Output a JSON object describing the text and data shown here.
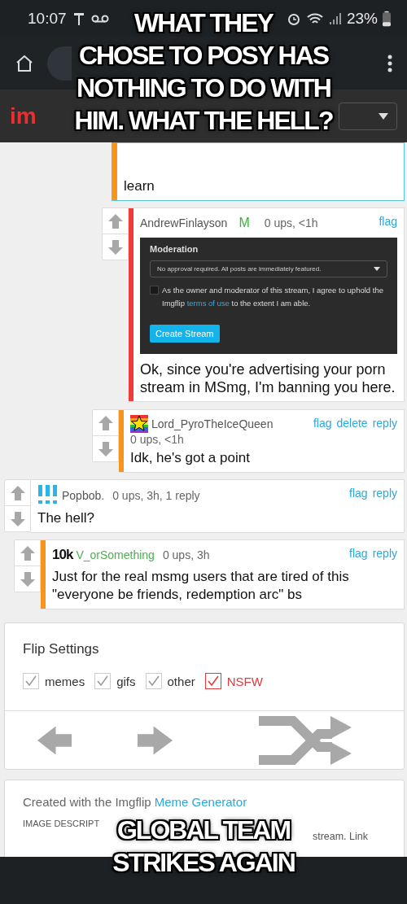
{
  "status_bar": {
    "time": "10:07",
    "battery": "23%"
  },
  "site_header": {
    "logo": "im"
  },
  "earlier_replies": [
    {
      "children": [
        {
          "children": [
            {
              "kind": "plain",
              "text": "learn",
              "stripe": {
                "color": "#f7941d"
              },
              "highlighted": true,
              "vote_buttons": false
            }
          ]
        },
        {
          "kind": "plain",
          "author": {
            "name": "AndrewFinlayson",
            "color": "#555555"
          },
          "badge": {
            "text": "M",
            "kind": "mod"
          },
          "meta": "0 ups, <1h",
          "actions": [
            "flag"
          ],
          "stripe": {
            "color": "#ee3b3b"
          },
          "highlighted": false,
          "vote_buttons": true,
          "attachment": {
            "title": "Moderation",
            "select": "No approval required. All posts are immediately featured.",
            "checked": false,
            "agreement": "As the owner and moderator of this stream, I agree to uphold the Imgflip **terms of use** to the extent I am able.",
            "button": "Create Stream"
          },
          "text": "Ok, since you're advertising your porn stream in MSmg, I'm banning you here."
        }
      ]
    },
    {
      "kind": "star-avatar",
      "author": {
        "name": "Lord_PyroTheIceQueen",
        "color": "#555555"
      },
      "meta": "0 ups, <1h",
      "actions": [
        "flag",
        "delete",
        "reply"
      ],
      "stripe": {
        "color": "#f7941d"
      },
      "highlighted": false,
      "vote_buttons": true,
      "text": "Idk, he's got a point"
    }
  ],
  "comments": [
    {
      "kind": "exclamation-avatar",
      "author": {
        "name": "Popbob.",
        "color": "#555555"
      },
      "meta": "0 ups, 3h, 1 reply",
      "actions": [
        "flag",
        "reply"
      ],
      "highlighted": false,
      "vote_buttons": true,
      "text": "The hell?",
      "children": [
        {
          "kind": "plain",
          "badge": {
            "text": "10k",
            "kind": "rank"
          },
          "author": {
            "name": "V_orSomething",
            "color": "#4caf50"
          },
          "meta": "0 ups, 3h",
          "actions": [
            "flag",
            "reply"
          ],
          "stripe": {
            "color": "#f7941d"
          },
          "highlighted": false,
          "vote_buttons": true,
          "text": "Just for the real msmg users that are tired of this \"everyone be friends, redemption arc\" bs"
        }
      ]
    }
  ],
  "flip_settings": {
    "title": "Flip Settings",
    "options": [
      {
        "label": "memes",
        "checked": true,
        "kind": "normal"
      },
      {
        "label": "gifs",
        "checked": true,
        "kind": "normal"
      },
      {
        "label": "other",
        "checked": true,
        "kind": "normal"
      },
      {
        "label": "NSFW",
        "checked": true,
        "kind": "warning"
      }
    ]
  },
  "created_card": {
    "intro": "Created with the Imgflip",
    "link": "Meme Generator",
    "description_heading": "IMAGE DESCRIPT",
    "description_fragment": "stream. Link"
  },
  "captions": {
    "top": [
      "WHAT THEY",
      "CHOSE TO POSY HAS",
      "NOTHING TO DO WITH",
      "HIM. WHAT THE HELL?"
    ],
    "bottom": [
      "GLOBAL TEAM",
      "STRIKES AGAIN"
    ]
  }
}
